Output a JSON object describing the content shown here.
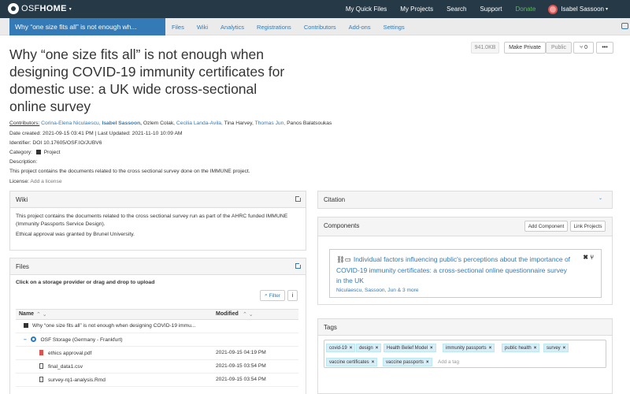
{
  "topnav": {
    "logo_osf": "OSF",
    "logo_home": "HOME",
    "links": [
      "My Quick Files",
      "My Projects",
      "Search",
      "Support"
    ],
    "donate": "Donate",
    "user_name": "Isabel Sassoon",
    "donate_color": "#5cb85c"
  },
  "projnav": {
    "title_tab": "Why “one size fits all” is not enough wh...",
    "tabs": [
      "Files",
      "Wiki",
      "Analytics",
      "Registrations",
      "Contributors",
      "Add-ons",
      "Settings"
    ]
  },
  "header": {
    "title": "Why “one size fits all” is not enough when designing COVID-19 immunity certificates for domestic use: a UK wide cross-sectional online survey",
    "size": "941.0KB",
    "make_private": "Make Private",
    "public": "Public",
    "fork_count": "0",
    "more": "•••"
  },
  "meta": {
    "contributors_label": "Contributors:",
    "contributors": [
      "Corina-Elena Niculaescu,",
      "Isabel Sassoon,",
      "Ozlem Colak,",
      "Cecilia Landa-Avila,",
      "Tina Harvey,",
      "Thomas Jun,",
      "Panos Balatsoukas"
    ],
    "dates": "Date created: 2021-09-15 03:41 PM | Last Updated: 2021-11-10 10:09 AM",
    "identifier": "Identifier: DOI 10.17605/OSF.IO/JUBV6",
    "category_label": "Category:",
    "category_value": "Project",
    "description_label": "Description:",
    "description": "This project contains the documents related to the cross sectional survey done on the IMMUNE project.",
    "license_label": "License:",
    "license_value": "Add a license"
  },
  "wiki": {
    "heading": "Wiki",
    "para1": "This project contains the documents related to the cross sectional survey run as part of the AHRC funded IMMUNE (Immunity Passports Service Design).",
    "para2": "Ethical approval was granted by Brunel University."
  },
  "files": {
    "heading": "Files",
    "subheading": "Click on a storage provider or drag and drop to upload",
    "filter": "Filter",
    "info": "i",
    "col_name": "Name",
    "col_modified": "Modified",
    "sort_arrows": "⌃ ⌄",
    "rows": [
      {
        "name": "Why “one size fits all” is not enough when designing COVID-19 immu...",
        "modified": "",
        "type": "project"
      },
      {
        "name": "OSF Storage (Germany - Frankfurt)",
        "modified": "",
        "type": "storage"
      },
      {
        "name": "ethics approval.pdf",
        "modified": "2021-09-15 04:19 PM",
        "type": "pdf"
      },
      {
        "name": "final_data1.csv",
        "modified": "2021-09-15 03:54 PM",
        "type": "file"
      },
      {
        "name": "survey-rq1-analysis.Rmd",
        "modified": "2021-09-15 03:54 PM",
        "type": "file"
      }
    ]
  },
  "citation": {
    "heading": "Citation"
  },
  "components": {
    "heading": "Components",
    "add_component": "Add Component",
    "link_projects": "Link Projects",
    "item_title": "Individual factors influencing public's perceptions about the importance of COVID-19 immunity certificates: a cross-sectional online questionnaire survey in the UK",
    "item_authors": [
      "Niculaescu,",
      "Sassoon,",
      "Jun"
    ],
    "item_more": "& 3 more"
  },
  "tags": {
    "heading": "Tags",
    "items": [
      "covid-19",
      "design",
      "Health Belief Model",
      "immunity passports",
      "public health",
      "survey",
      "vaccine certificates",
      "vaccine passports"
    ],
    "add_placeholder": "Add a tag"
  }
}
